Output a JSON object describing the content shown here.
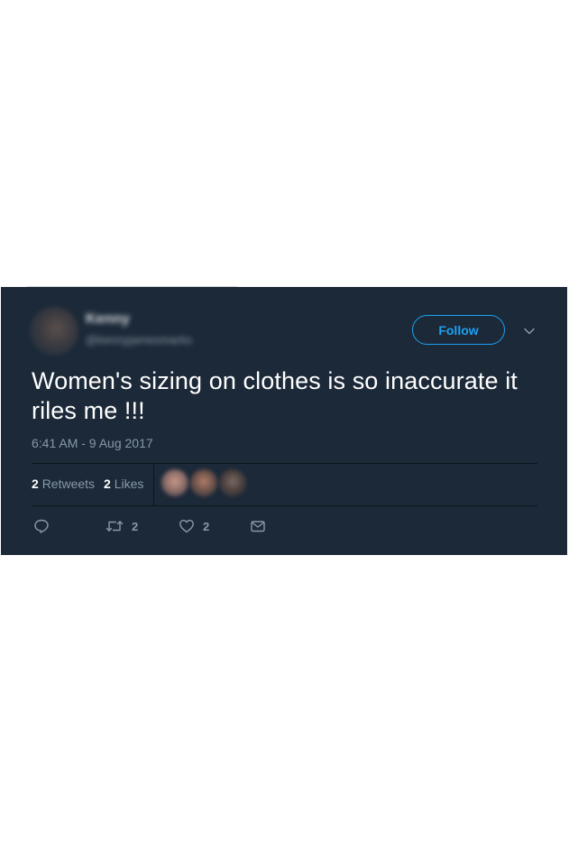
{
  "tweet": {
    "author": {
      "display_name": "Kenny",
      "handle": "@kennyjamesmarks"
    },
    "follow_label": "Follow",
    "text": "Women's sizing on clothes is so inaccurate it riles me !!!",
    "timestamp": "6:41 AM - 9 Aug 2017",
    "stats": {
      "retweets_count": "2",
      "retweets_label": "Retweets",
      "likes_count": "2",
      "likes_label": "Likes"
    },
    "actions": {
      "retweet_count": "2",
      "like_count": "2"
    }
  },
  "colors": {
    "card_background": "#1c2938",
    "accent": "#1da1f2",
    "muted_text": "#8899a6",
    "primary_text": "#ffffff"
  },
  "icons": [
    "chevron-down-icon",
    "reply-icon",
    "retweet-icon",
    "heart-icon",
    "mail-icon"
  ]
}
